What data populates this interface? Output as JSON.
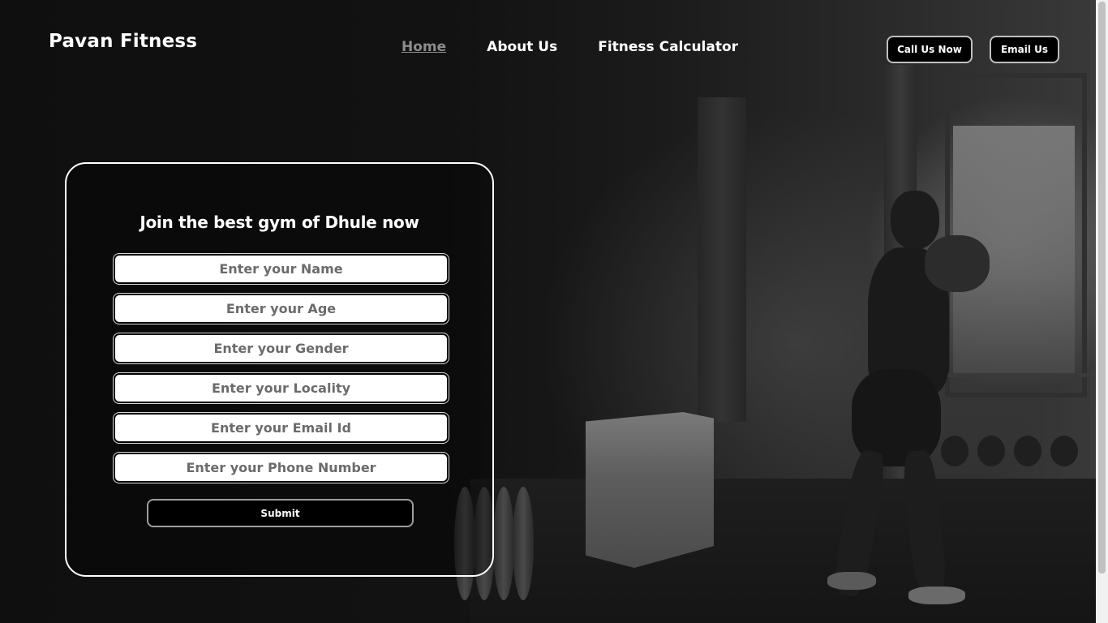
{
  "header": {
    "brand": "Pavan Fitness",
    "nav": [
      {
        "label": "Home",
        "active": true
      },
      {
        "label": "About Us",
        "active": false
      },
      {
        "label": "Fitness Calculator",
        "active": false
      }
    ],
    "call_label": "Call Us Now",
    "email_label": "Email Us"
  },
  "form": {
    "title": "Join the best gym of Dhule now",
    "fields": [
      {
        "placeholder": "Enter your Name",
        "value": ""
      },
      {
        "placeholder": "Enter your Age",
        "value": ""
      },
      {
        "placeholder": "Enter your Gender",
        "value": ""
      },
      {
        "placeholder": "Enter your Locality",
        "value": ""
      },
      {
        "placeholder": "Enter your Email Id",
        "value": ""
      },
      {
        "placeholder": "Enter your Phone Number",
        "value": ""
      }
    ],
    "submit_label": "Submit"
  },
  "background": {
    "image_description_icon": "gym-boxer-photo-icon"
  },
  "colors": {
    "background": "#111111",
    "text": "#ffffff",
    "active_nav": "#8c8c8c",
    "button_bg": "#000000"
  }
}
